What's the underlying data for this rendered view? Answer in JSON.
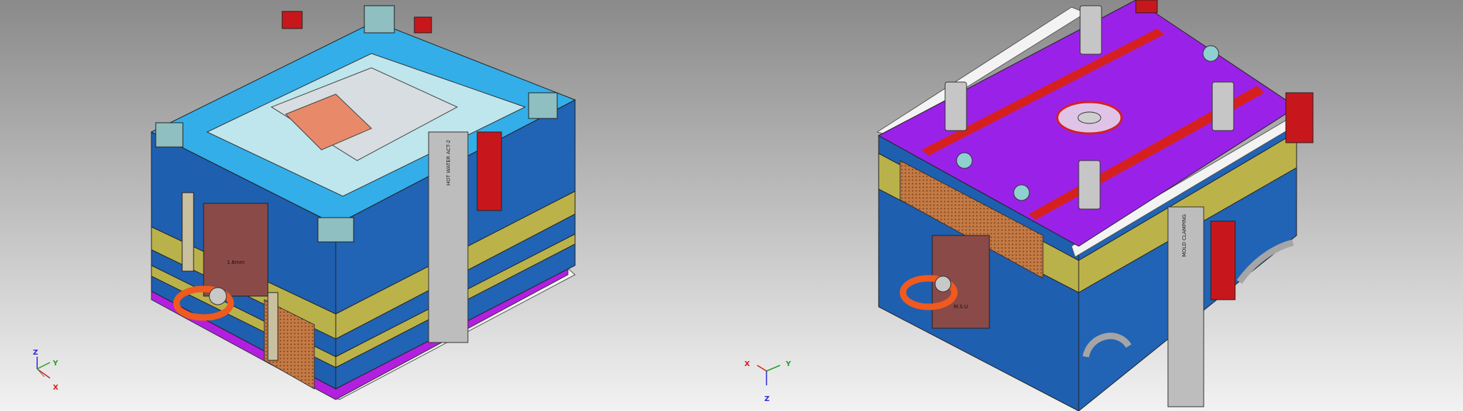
{
  "viewport": {
    "background_top": "#8a8a8a",
    "background_bottom": "#f2f2f2"
  },
  "views": [
    {
      "name": "mold-assembly-fixed-half",
      "triad": {
        "labels": {
          "z": "Z",
          "y": "Y",
          "x": "X"
        }
      },
      "part_markings": [
        "1.6mm",
        "HOT WATER ACT-2"
      ]
    },
    {
      "name": "mold-assembly-moving-half",
      "triad": {
        "labels": {
          "x": "X",
          "y": "Y",
          "z": "Z"
        }
      },
      "part_markings": [
        "M.S.U",
        "MOLD CLAMPING"
      ]
    }
  ],
  "colors": {
    "axis_x": "#d62020",
    "axis_y": "#1fa31f",
    "axis_z": "#2a2ad6",
    "plate_blue": "#1f5fb0",
    "plate_cyan": "#33aee8",
    "plate_olive": "#b9b24a",
    "plate_purple": "#9a22e8",
    "clamp_red": "#c8171c",
    "lift_orange": "#f05a1f",
    "strap_grey": "#bdbdbd",
    "rail_white": "#f3f3f3"
  }
}
